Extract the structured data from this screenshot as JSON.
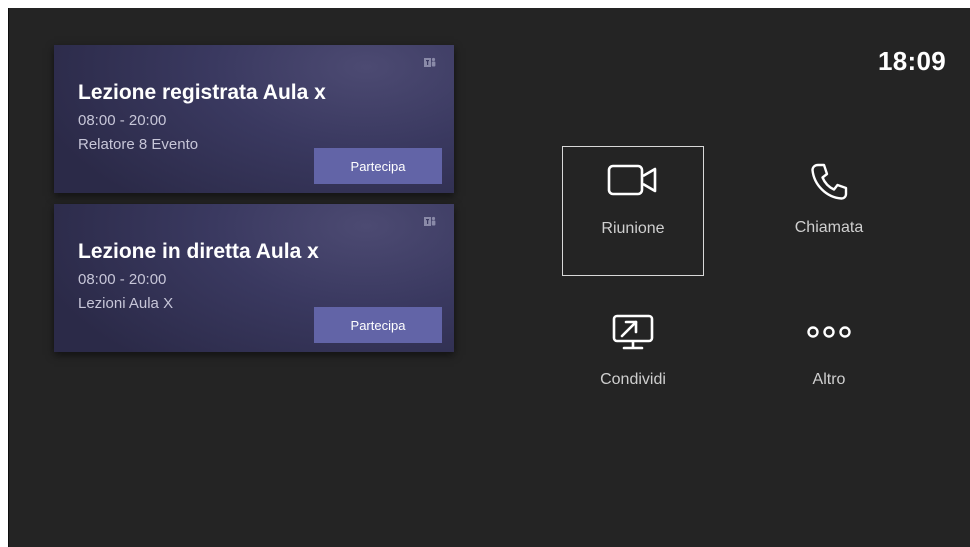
{
  "clock": {
    "time": "18:09"
  },
  "meetings": [
    {
      "title": "Lezione registrata Aula x",
      "time": "08:00 - 20:00",
      "subtitle": "Relatore 8 Evento",
      "join_label": "Partecipa"
    },
    {
      "title": "Lezione in diretta Aula x",
      "time": "08:00 - 20:00",
      "subtitle": "Lezioni Aula X",
      "join_label": "Partecipa"
    }
  ],
  "actions": {
    "meeting": {
      "label": "Riunione",
      "icon": "video-camera-icon"
    },
    "call": {
      "label": "Chiamata",
      "icon": "phone-icon"
    },
    "share": {
      "label": "Condividi",
      "icon": "screen-share-icon"
    },
    "more": {
      "label": "Altro",
      "icon": "more-icon"
    }
  },
  "colors": {
    "background": "#242424",
    "card": "#3a3960",
    "accent": "#6264a7",
    "text": "#ffffff"
  }
}
